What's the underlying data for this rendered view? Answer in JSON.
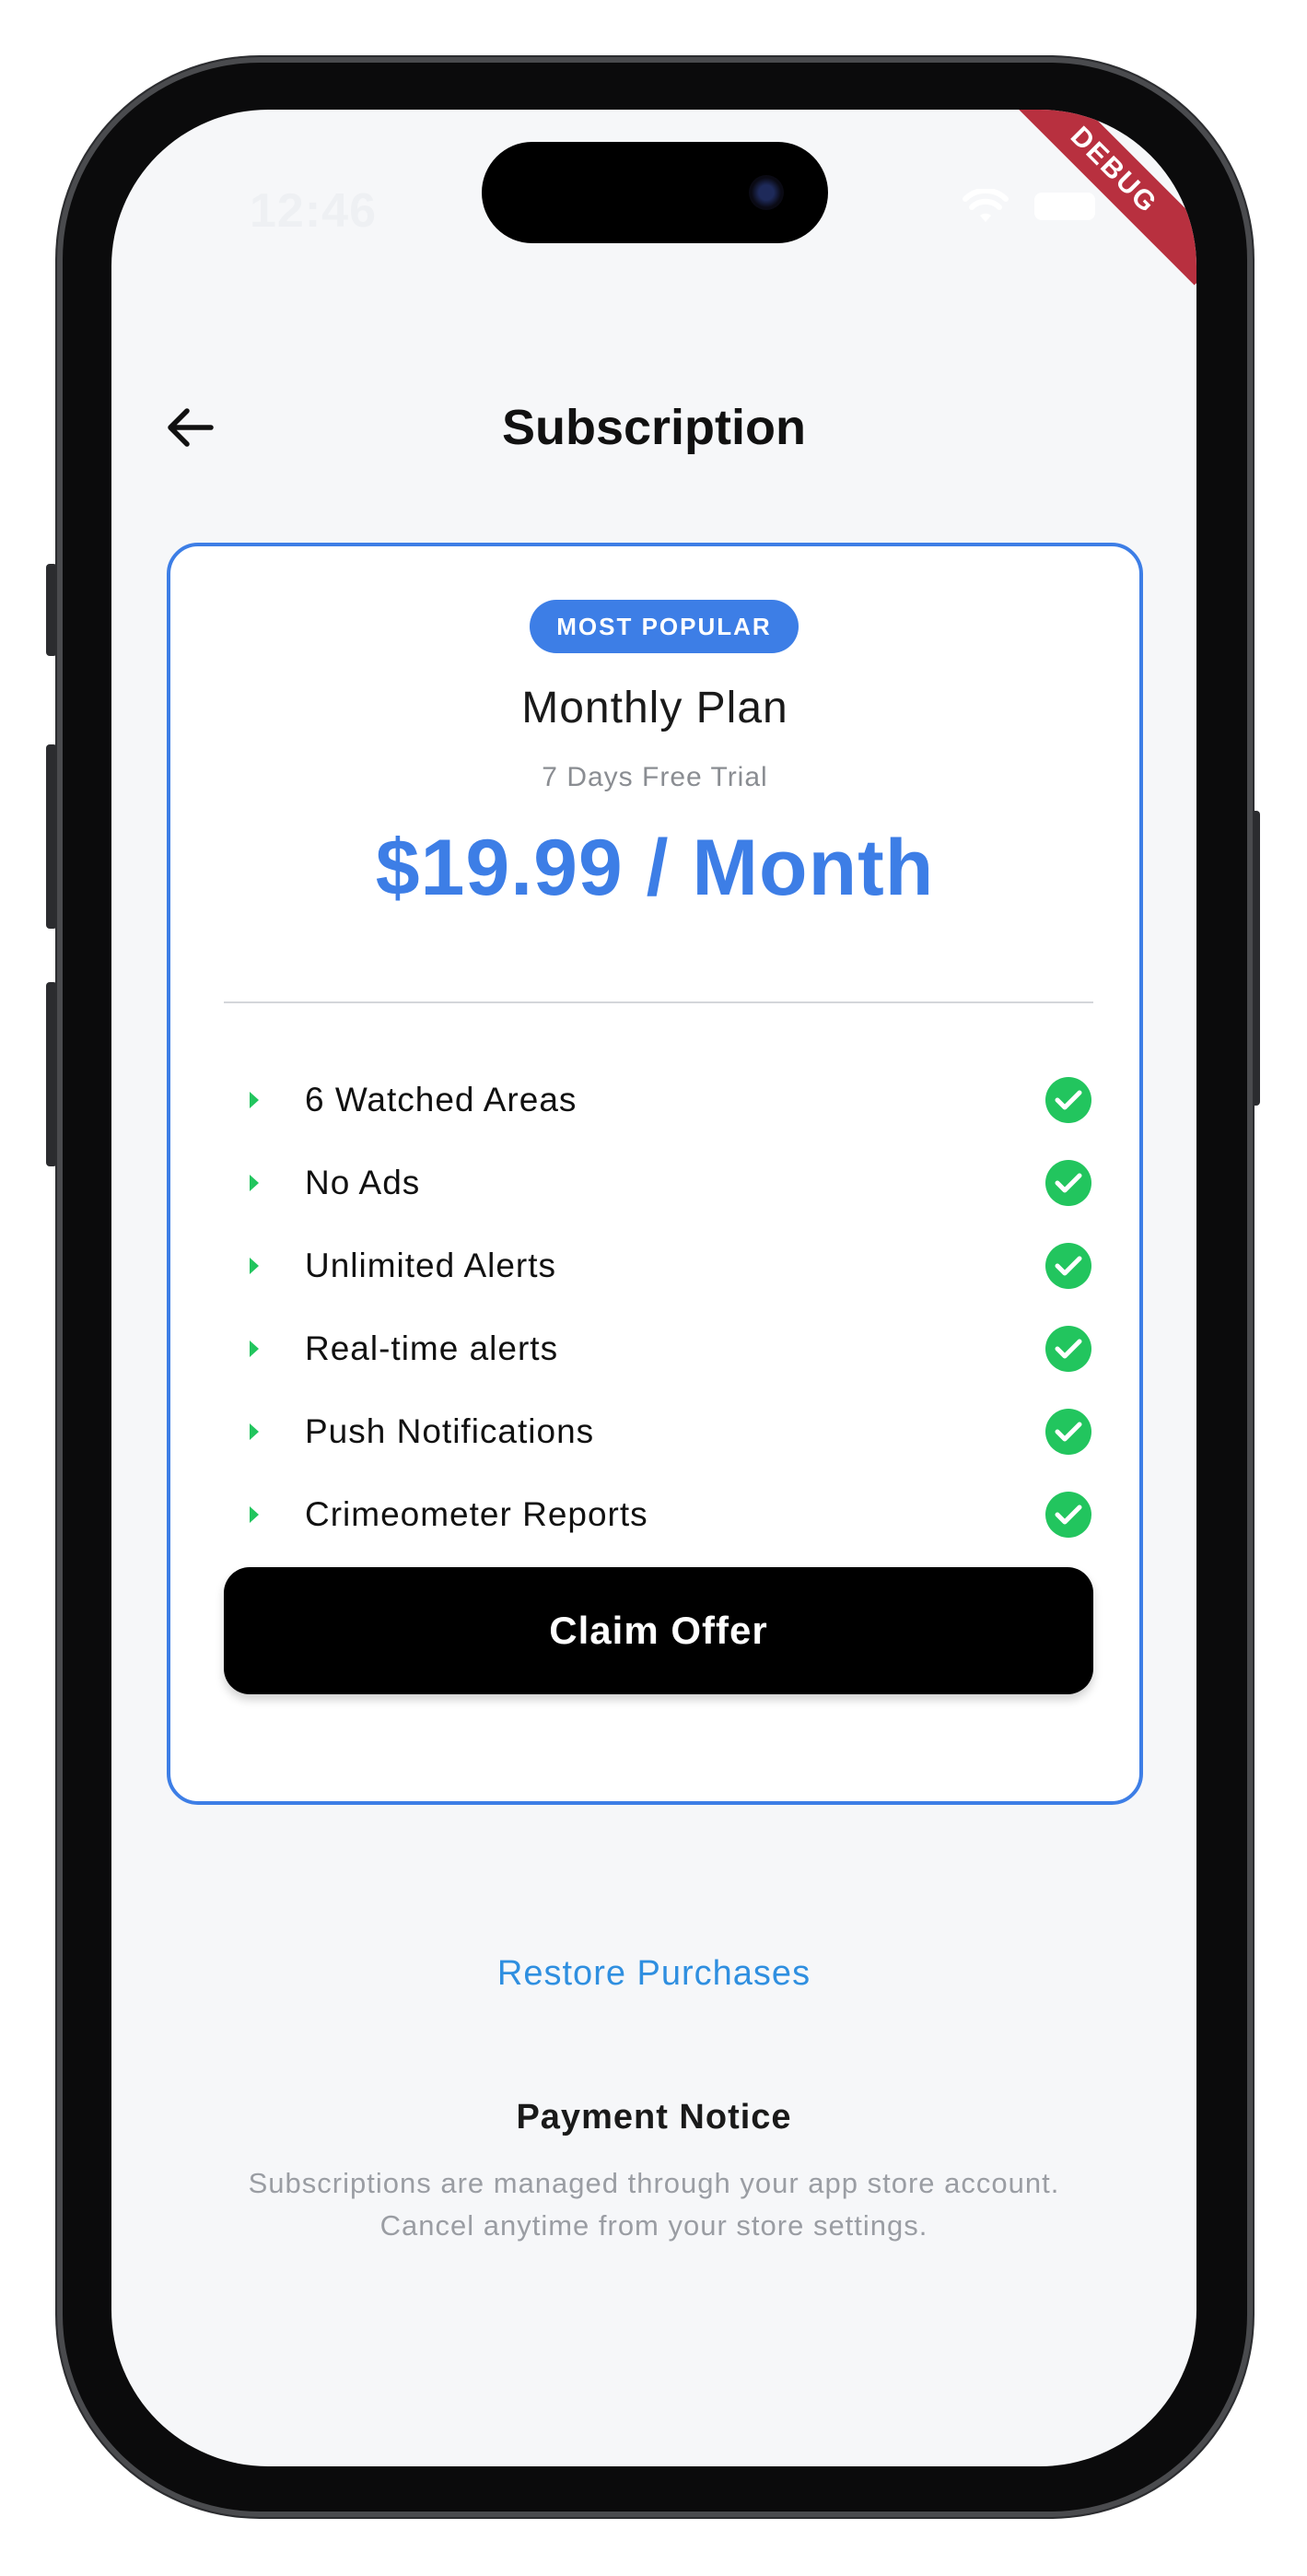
{
  "status_bar": {
    "time": "12:46",
    "debug_label": "DEBUG"
  },
  "app_bar": {
    "title": "Subscription",
    "back_icon": "arrow-left-icon"
  },
  "plan": {
    "badge": "MOST POPULAR",
    "name": "Monthly Plan",
    "trial": "7 Days Free Trial",
    "price": "$19.99 / Month",
    "features": [
      {
        "label": "6 Watched Areas",
        "included": true
      },
      {
        "label": "No Ads",
        "included": true
      },
      {
        "label": "Unlimited Alerts",
        "included": true
      },
      {
        "label": "Real-time alerts",
        "included": true
      },
      {
        "label": "Push Notifications",
        "included": true
      },
      {
        "label": "Crimeometer Reports",
        "included": true
      }
    ],
    "cta_label": "Claim Offer"
  },
  "footer": {
    "restore_label": "Restore Purchases",
    "notice_title": "Payment Notice",
    "notice_line1": "Subscriptions are managed through your app store account.",
    "notice_line2": "Cancel anytime from your store settings."
  },
  "colors": {
    "accent": "#3d7ee6",
    "check": "#22c55e",
    "link": "#2f8fe0",
    "background": "#f6f7f9"
  }
}
